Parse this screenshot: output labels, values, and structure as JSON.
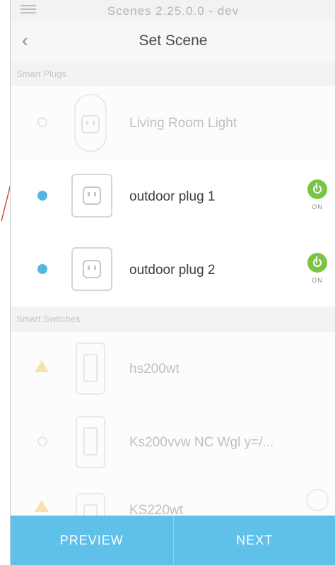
{
  "statusbar": {
    "title": "Scenes 2.25.0.0 - dev"
  },
  "header": {
    "title": "Set Scene",
    "back_icon": "chevron-left-icon"
  },
  "sections": [
    {
      "label": "Smart Plugs",
      "items": [
        {
          "name": "Living Room Light",
          "selected": false,
          "dimmed": true,
          "status": ""
        },
        {
          "name": "outdoor plug 1",
          "selected": true,
          "dimmed": false,
          "status": "ON"
        },
        {
          "name": "outdoor plug 2",
          "selected": true,
          "dimmed": false,
          "status": "ON"
        }
      ]
    },
    {
      "label": "Smart Switches",
      "items": [
        {
          "name": "hs200wt",
          "selected": false,
          "dimmed": true,
          "warning": true
        },
        {
          "name": "Ks200vvw  NC Wgl y=/...",
          "selected": false,
          "dimmed": true,
          "warning": false
        },
        {
          "name": "KS220wt",
          "selected": false,
          "dimmed": true,
          "warning": true
        }
      ]
    }
  ],
  "footer": {
    "preview_label": "PREVIEW",
    "next_label": "NEXT"
  },
  "colors": {
    "accent": "#5fc0ea",
    "selected_radio": "#53b6e4",
    "power_on": "#7cc443",
    "warning": "#f2c65a"
  }
}
